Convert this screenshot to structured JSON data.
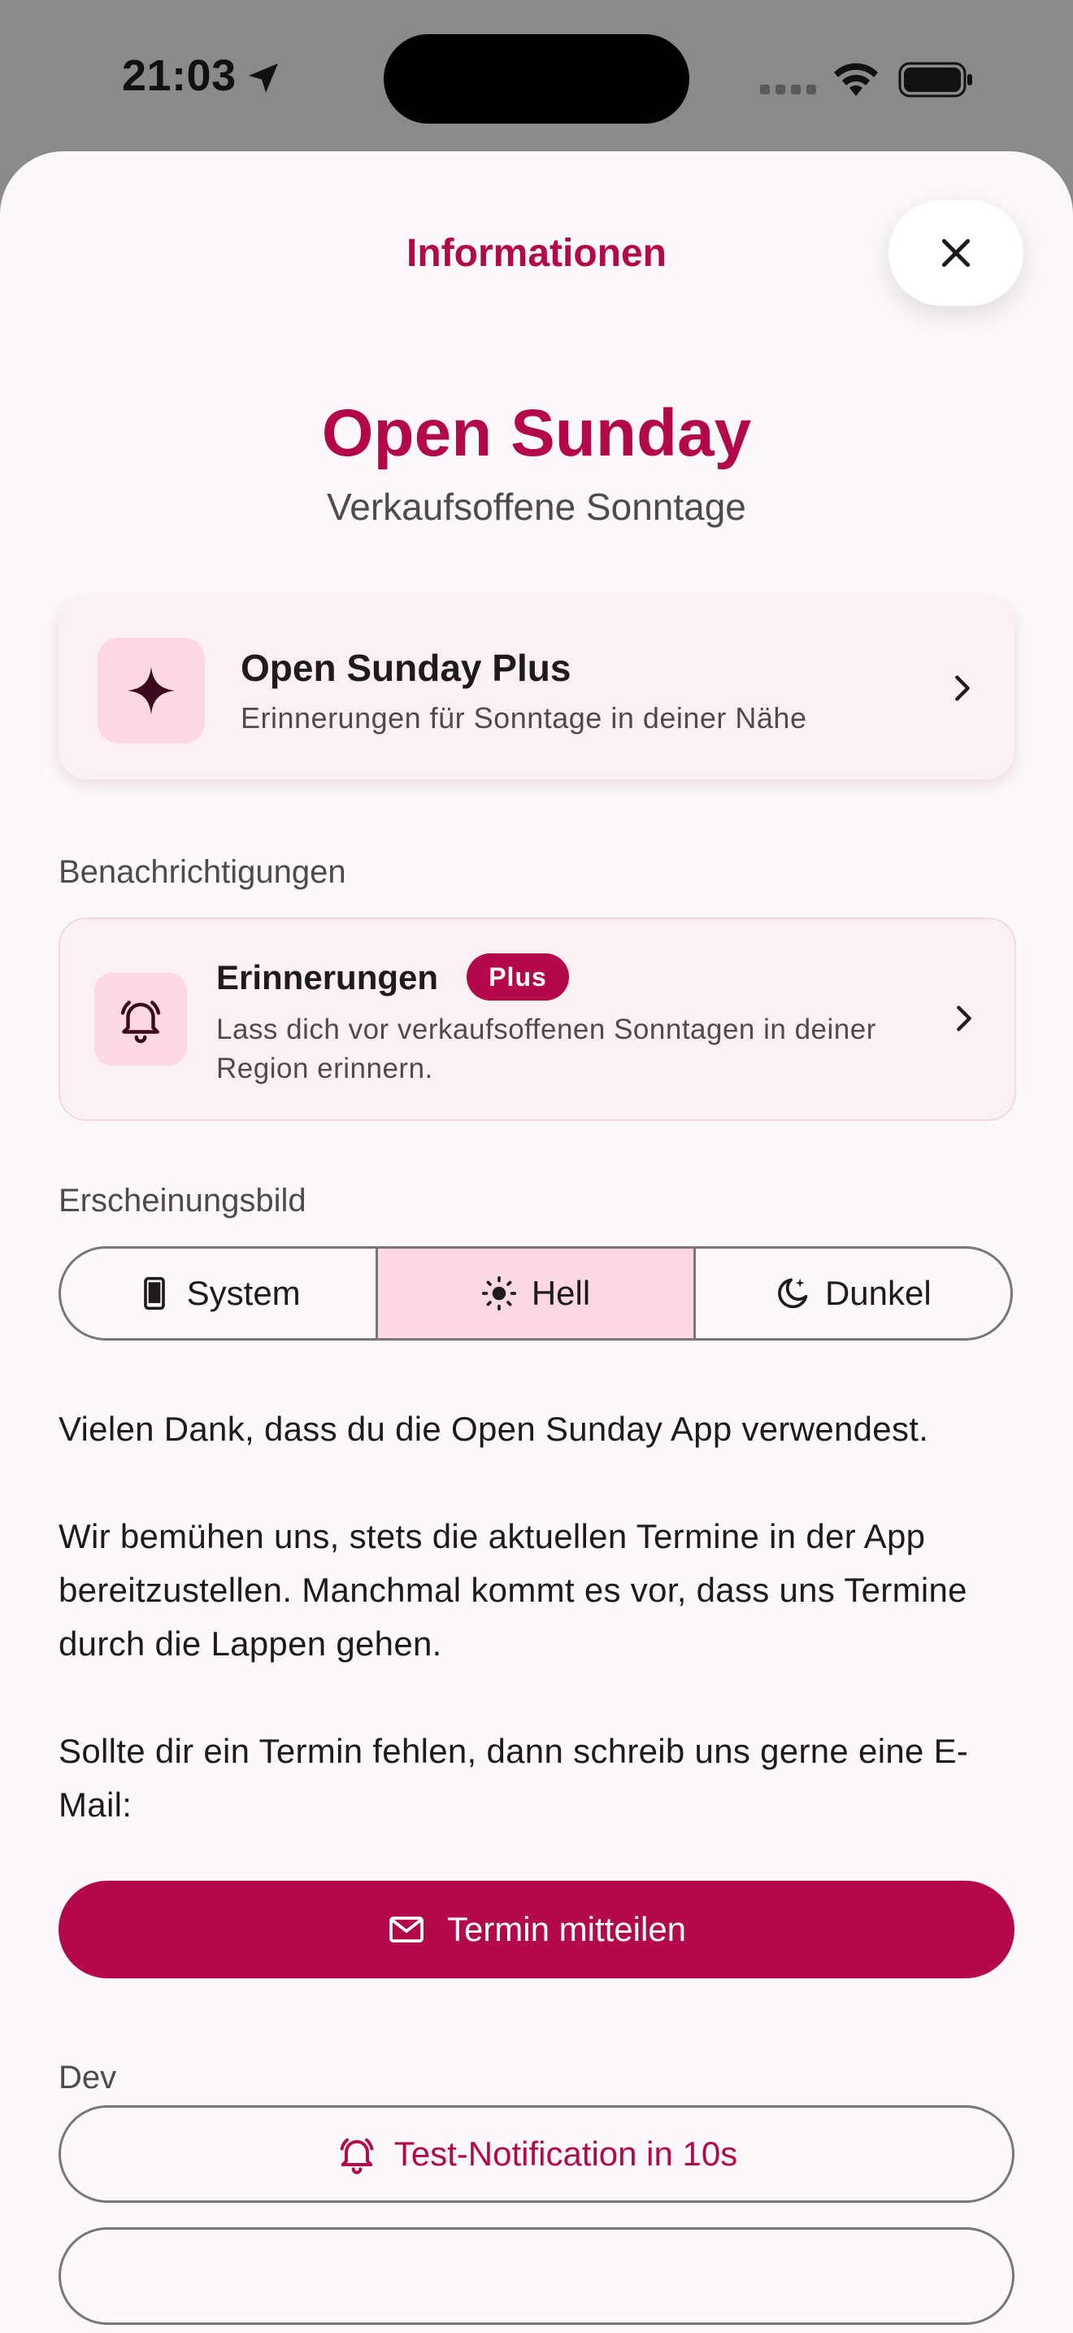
{
  "status_bar": {
    "time": "21:03"
  },
  "sheet": {
    "title": "Informationen",
    "close_icon": "close-icon"
  },
  "app": {
    "name": "Open Sunday",
    "subtitle": "Verkaufsoffene Sonntage"
  },
  "plus_card": {
    "icon": "sparkle-icon",
    "title": "Open Sunday Plus",
    "description": "Erinnerungen für Sonntage in deiner Nähe"
  },
  "notifications": {
    "section_label": "Benachrichtigungen",
    "icon": "bell-ring-icon",
    "title": "Erinnerungen",
    "badge": "Plus",
    "description": "Lass dich vor verkaufsoffenen Sonntagen in deiner Region erinnern."
  },
  "appearance": {
    "section_label": "Erscheinungsbild",
    "options": [
      {
        "label": "System",
        "icon": "phone-icon"
      },
      {
        "label": "Hell",
        "icon": "sun-icon"
      },
      {
        "label": "Dunkel",
        "icon": "moon-icon"
      }
    ],
    "selected": "Hell"
  },
  "info_text": {
    "p1": "Vielen Dank, dass du die Open Sunday App verwendest.",
    "p2": "Wir bemühen uns, stets die aktuellen Termine in der App bereitzustellen. Manchmal kommt es vor, dass uns Termine durch die Lappen gehen.",
    "p3": "Sollte dir ein Termin fehlen, dann schreib uns gerne eine E-Mail:"
  },
  "report_button": {
    "label": "Termin mitteilen",
    "icon": "mail-icon"
  },
  "dev": {
    "section_label": "Dev",
    "test_button": {
      "label": "Test-Notification in 10s",
      "icon": "bell-ring-icon"
    }
  },
  "colors": {
    "accent": "#b3094b",
    "card_bg": "#fcf1f2",
    "tile_bg": "#fcd9e2",
    "sheet_bg": "#fcf8fb"
  }
}
